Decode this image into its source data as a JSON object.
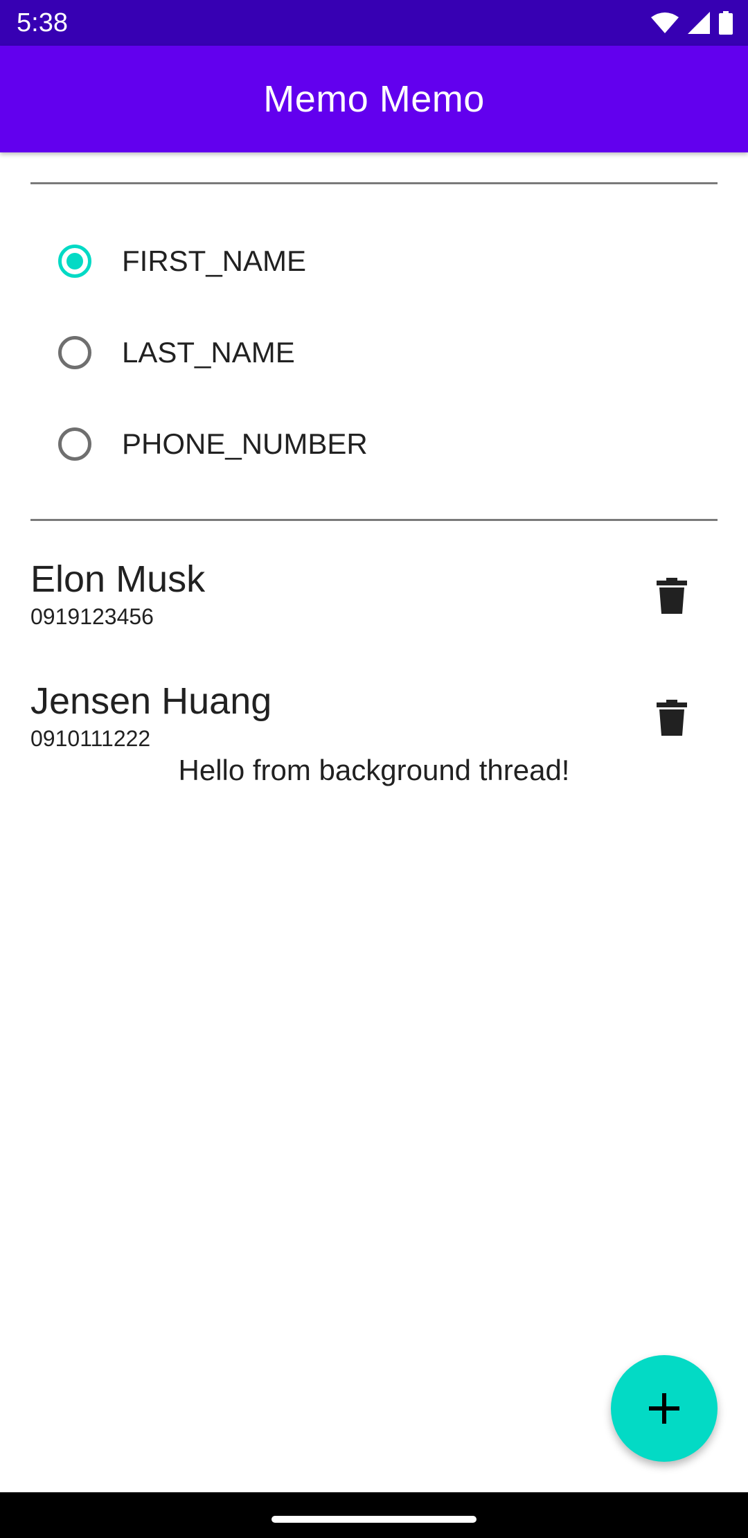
{
  "status_bar": {
    "time": "5:38",
    "icons": [
      "wifi-icon",
      "cellular-signal-icon",
      "battery-icon"
    ]
  },
  "app_bar": {
    "title": "Memo Memo",
    "color": "#6200ee"
  },
  "sort_options": {
    "selected": "FIRST_NAME",
    "items": [
      {
        "label": "FIRST_NAME",
        "checked": true
      },
      {
        "label": "LAST_NAME",
        "checked": false
      },
      {
        "label": "PHONE_NUMBER",
        "checked": false
      }
    ]
  },
  "contacts": [
    {
      "name": "Elon Musk",
      "phone": "0919123456",
      "action_icon": "delete-icon"
    },
    {
      "name": "Jensen Huang",
      "phone": "0910111222",
      "action_icon": "delete-icon"
    }
  ],
  "message": "Hello from background thread!",
  "fab": {
    "icon": "add-icon",
    "color": "#03dac5"
  },
  "colors": {
    "status_bar": "#3700b3",
    "accent": "#03dac5"
  }
}
